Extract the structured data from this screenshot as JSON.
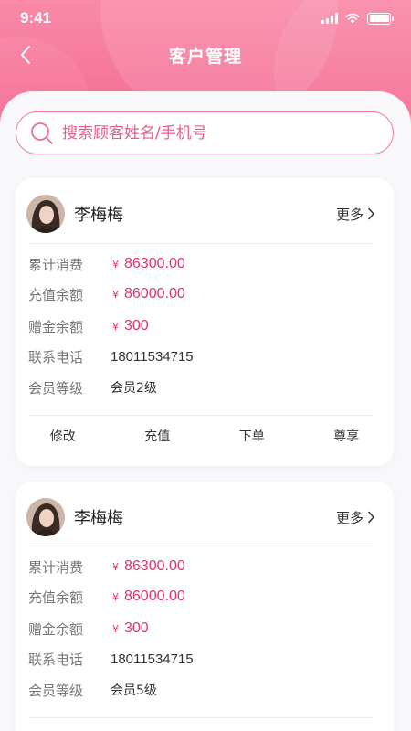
{
  "status_bar": {
    "time": "9:41"
  },
  "nav": {
    "title": "客户管理"
  },
  "search": {
    "placeholder": "搜索顾客姓名/手机号"
  },
  "labels": {
    "total_spent": "累计消费",
    "balance": "充值余额",
    "bonus": "赠金余额",
    "phone": "联系电话",
    "level": "会员等级",
    "more": "更多",
    "currency": "¥"
  },
  "actions": [
    "修改",
    "充值",
    "下单",
    "尊享"
  ],
  "customers": [
    {
      "name": "李梅梅",
      "total_spent": "86300.00",
      "balance": "86000.00",
      "bonus": "300",
      "phone": "18011534715",
      "level": "会员2级"
    },
    {
      "name": "李梅梅",
      "total_spent": "86300.00",
      "balance": "86000.00",
      "bonus": "300",
      "phone": "18011534715",
      "level": "会员5级"
    }
  ],
  "colors": {
    "brand": "#f56f96",
    "money": "#e0336c"
  }
}
